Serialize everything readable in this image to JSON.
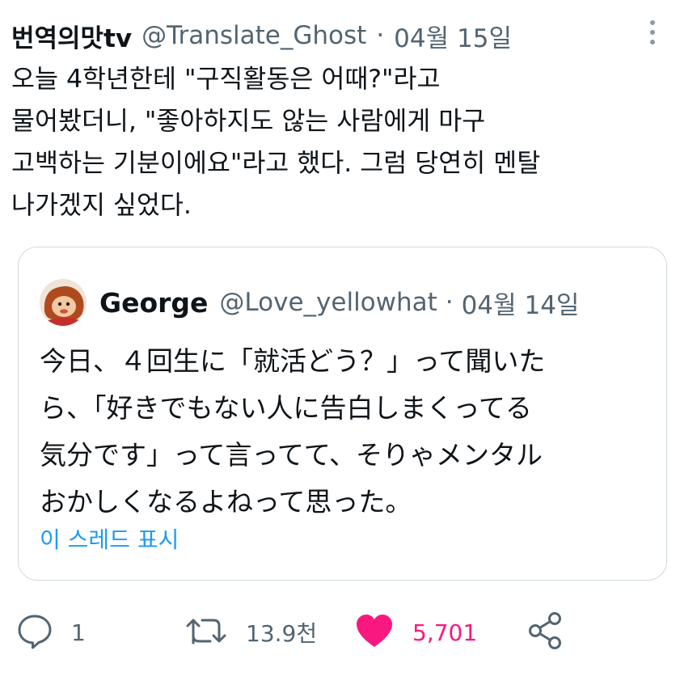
{
  "tweet": {
    "display_name": "번역의맛tv",
    "handle": "@Translate_Ghost",
    "separator": "·",
    "date": "04월 15일",
    "text": "오늘 4학년한테 \"구직활동은 어때?\"라고\n물어봤더니, \"좋아하지도 않는 사람에게 마구\n고백하는 기분이에요\"라고 했다. 그럼 당연히 멘탈\n나가겠지 싶었다."
  },
  "quote": {
    "display_name": "George",
    "handle": "@Love_yellowhat",
    "separator": "·",
    "date": "04월 14일",
    "text": "今日、４回生に「就活どう？」って聞いた\nら、「好きでもない人に告白しまくってる\n気分です」って言ってて、そりゃメンタル\nおかしくなるよねって思った。",
    "show_thread": "이 스레드 표시"
  },
  "actions": {
    "reply_count": "1",
    "retweet_count": "13.9천",
    "like_count": "5,701"
  },
  "colors": {
    "text": "#0f1419",
    "muted": "#536471",
    "link": "#1d9bf0",
    "like": "#f91880",
    "border": "#cfd9de"
  },
  "icons": [
    "more-vertical-icon",
    "reply-icon",
    "retweet-icon",
    "heart-icon",
    "share-icon"
  ]
}
